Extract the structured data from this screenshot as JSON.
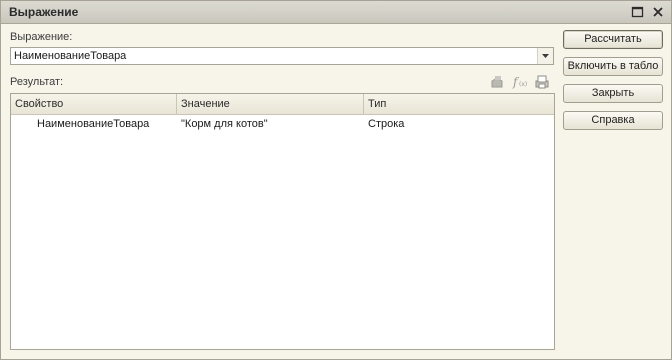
{
  "window": {
    "title": "Выражение"
  },
  "expression": {
    "label": "Выражение:",
    "value": "НаименованиеТовара"
  },
  "result": {
    "label": "Результат:"
  },
  "table": {
    "columns": [
      "Свойство",
      "Значение",
      "Тип"
    ],
    "rows": [
      {
        "property": "НаименованиеТовара",
        "value": "\"Корм для котов\"",
        "type": "Строка"
      }
    ]
  },
  "buttons": {
    "calculate": "Рассчитать",
    "include_in_table": "Включить в табло",
    "close": "Закрыть",
    "help": "Справка"
  },
  "icons": {
    "maximize": "maximize-icon",
    "close": "close-icon",
    "tool_1": "insert-icon",
    "tool_2": "function-icon",
    "tool_3": "print-icon",
    "combo": "chevron-down-icon"
  }
}
